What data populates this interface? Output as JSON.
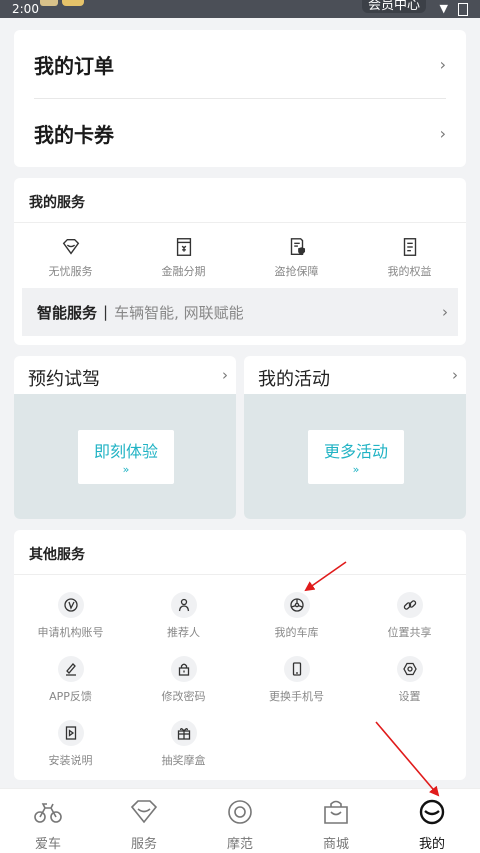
{
  "status_bar": {
    "time": "2:00",
    "network_text": "会员中心"
  },
  "orders": [
    {
      "label": "我的订单",
      "chevron": "›"
    },
    {
      "label": "我的卡券",
      "chevron": "›"
    }
  ],
  "my_services": {
    "title": "我的服务",
    "items": [
      {
        "label": "无忧服务",
        "icon": "diamond-icon"
      },
      {
        "label": "金融分期",
        "icon": "finance-box-icon"
      },
      {
        "label": "盗抢保障",
        "icon": "document-shield-icon"
      },
      {
        "label": "我的权益",
        "icon": "list-document-icon"
      }
    ],
    "smart": {
      "bold": "智能服务",
      "separator": "|",
      "desc": "车辆智能, 网联赋能",
      "chevron": "›"
    }
  },
  "promos": {
    "test_drive": {
      "title": "预约试驾",
      "chevron": "›",
      "button": "即刻体验",
      "button_arrow": "»"
    },
    "activities": {
      "title": "我的活动",
      "chevron": "›",
      "button": "更多活动",
      "button_arrow": "»"
    }
  },
  "other_services": {
    "title": "其他服务",
    "items": [
      {
        "label": "申请机构账号",
        "icon": "clock-badge-icon"
      },
      {
        "label": "推荐人",
        "icon": "person-icon"
      },
      {
        "label": "我的车库",
        "icon": "wheel-icon"
      },
      {
        "label": "位置共享",
        "icon": "link-icon"
      },
      {
        "label": "APP反馈",
        "icon": "edit-pen-icon"
      },
      {
        "label": "修改密码",
        "icon": "lock-icon"
      },
      {
        "label": "更换手机号",
        "icon": "phone-icon"
      },
      {
        "label": "设置",
        "icon": "settings-hex-icon"
      },
      {
        "label": "安装说明",
        "icon": "play-document-icon"
      },
      {
        "label": "抽奖摩盒",
        "icon": "gift-icon"
      }
    ]
  },
  "tabbar": {
    "items": [
      {
        "label": "爱车",
        "icon": "motorcycle-icon",
        "active": false
      },
      {
        "label": "服务",
        "icon": "diamond-icon",
        "active": false
      },
      {
        "label": "摩范",
        "icon": "target-icon",
        "active": false
      },
      {
        "label": "商城",
        "icon": "shopping-bag-icon",
        "active": false
      },
      {
        "label": "我的",
        "icon": "face-icon",
        "active": true
      }
    ]
  },
  "colors": {
    "accent": "#21b3c4",
    "annotation_arrow": "#e01b1b",
    "banner_bg": "#dee6e8"
  }
}
